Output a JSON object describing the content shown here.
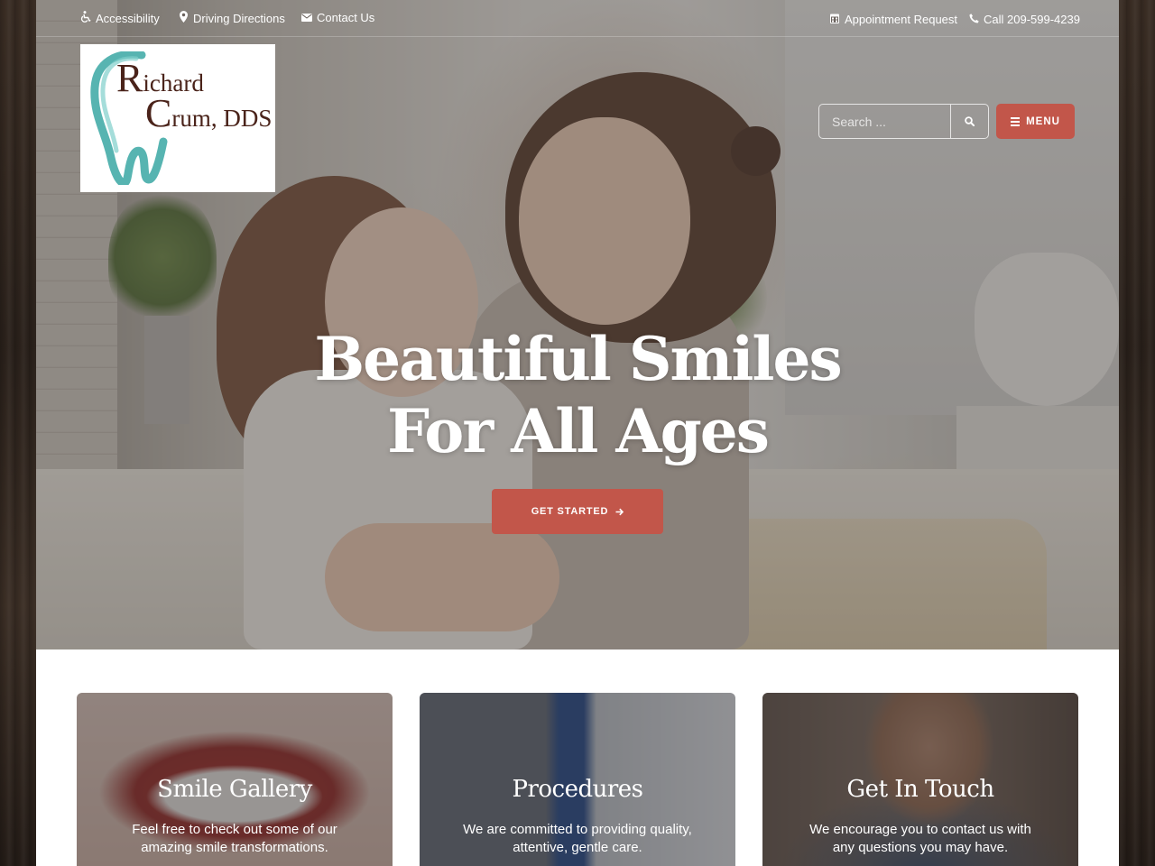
{
  "topbar": {
    "accessibility": "Accessibility",
    "directions": "Driving Directions",
    "contact": "Contact Us",
    "appointment": "Appointment Request",
    "call": "Call 209-599-4239",
    "icons": {
      "accessibility": "wheelchair-icon",
      "directions": "map-marker-icon",
      "contact": "envelope-icon",
      "appointment": "calendar-icon",
      "call": "phone-icon"
    }
  },
  "logo": {
    "line1_initial": "R",
    "line1_rest": "ichard",
    "line2_initial": "C",
    "line2_rest": "rum, DDS"
  },
  "search": {
    "placeholder": "Search ...",
    "icon": "search-icon"
  },
  "menu": {
    "label": "MENU",
    "icon": "hamburger-icon"
  },
  "hero": {
    "headline_line1": "Beautiful Smiles",
    "headline_line2": "For All Ages",
    "cta_label": "GET STARTED",
    "cta_icon": "arrow-right-icon"
  },
  "cards": [
    {
      "title": "Smile Gallery",
      "text": "Feel free to check out some of our amazing smile transformations."
    },
    {
      "title": "Procedures",
      "text": "We are committed to providing quality, attentive, gentle care."
    },
    {
      "title": "Get In Touch",
      "text": "We encourage you to contact us with any questions you may have."
    }
  ],
  "colors": {
    "accent": "#c2564a",
    "logo_text": "#4a231a",
    "logo_tooth": "#3aa7a3"
  }
}
